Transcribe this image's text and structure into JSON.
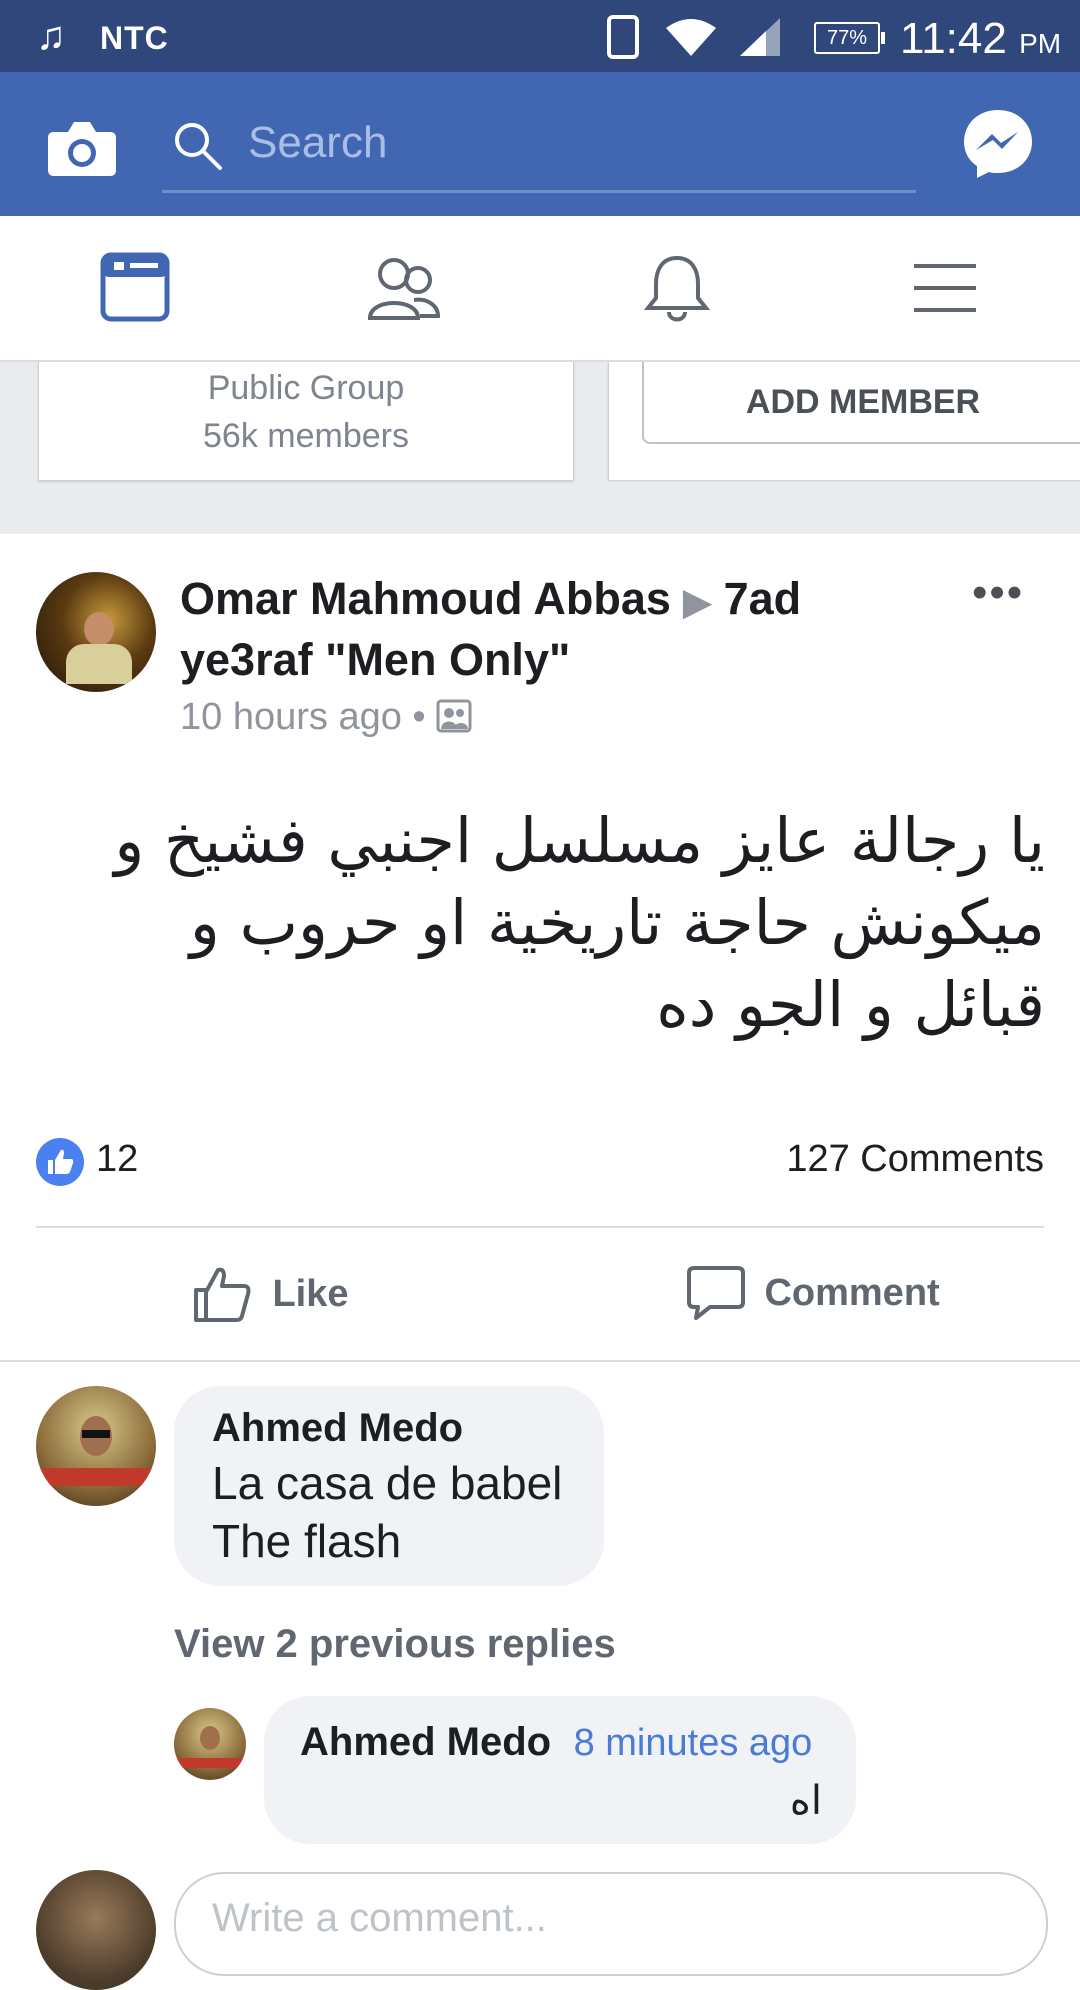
{
  "status_bar": {
    "carrier": "NTC",
    "battery": "77%",
    "time": "11:42",
    "ampm": "PM"
  },
  "topbar": {
    "search_placeholder": "Search",
    "icons": [
      "camera-icon",
      "search-icon",
      "messenger-icon"
    ]
  },
  "nav": {
    "tabs": [
      "news-feed-icon",
      "friends-icon",
      "notifications-icon",
      "menu-icon"
    ],
    "active": "news-feed-icon"
  },
  "group": {
    "type": "Public Group",
    "members": "56k members",
    "add_member_label": "ADD MEMBER"
  },
  "post": {
    "author": "Omar Mahmoud Abbas",
    "group_name": "7ad ye3raf \"Men Only\"",
    "time": "10 hours ago",
    "separator": "•",
    "text": "يا رجالة عايز مسلسل اجنبي فشيخ و ميكونش حاجة تاريخية او حروب و قبائل و الجو ده",
    "likes": "12",
    "comments_count": "127 Comments",
    "like_label": "Like",
    "comment_label": "Comment"
  },
  "comments": [
    {
      "name": "Ahmed Medo",
      "lines": [
        "La casa de babel",
        "The flash"
      ]
    }
  ],
  "view_replies": "View 2 previous replies",
  "reply": {
    "name": "Ahmed Medo",
    "time": "8 minutes ago",
    "text": "اه"
  },
  "composer": {
    "placeholder": "Write a comment..."
  },
  "colors": {
    "status_bar": "#2f477a",
    "brand_blue": "#4267b2",
    "link_blue": "#4a7bd6"
  }
}
